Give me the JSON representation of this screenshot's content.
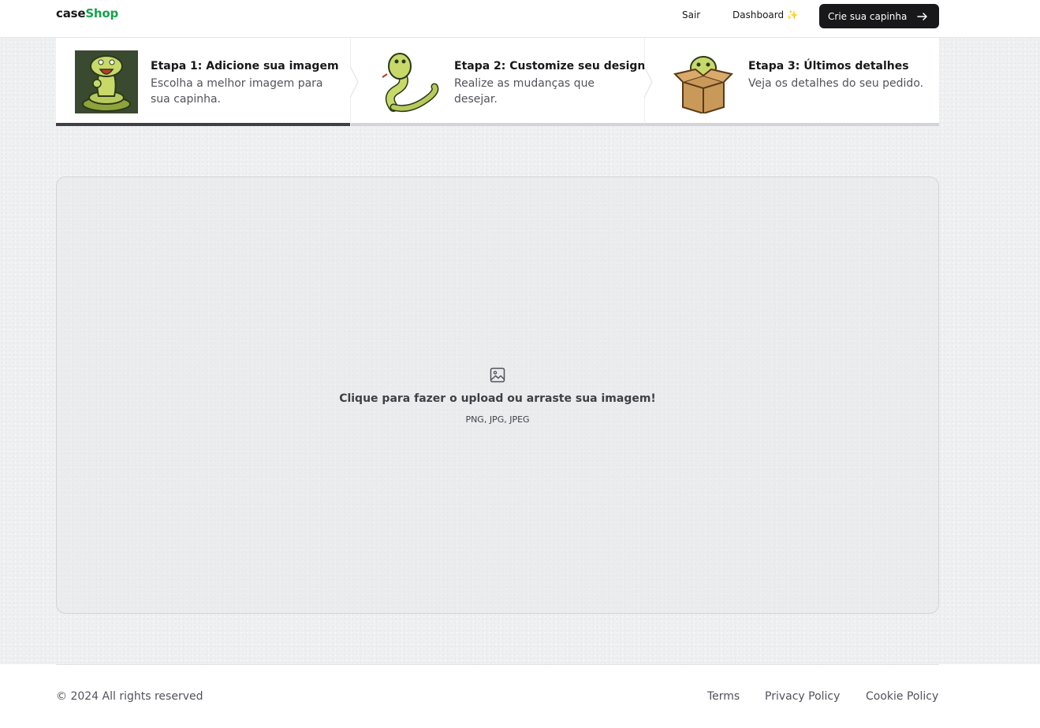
{
  "header": {
    "logo_part1": "case",
    "logo_part2": "Shop",
    "nav": {
      "logout": "Sair",
      "dashboard": "Dashboard ✨",
      "cta": "Crie sua capinha"
    }
  },
  "steps": [
    {
      "title": "Etapa 1: Adicione sua imagem",
      "description": "Escolha a melhor imagem para sua capinha.",
      "active": true
    },
    {
      "title": "Etapa 2: Customize seu design",
      "description": "Realize as mudanças que desejar.",
      "active": false
    },
    {
      "title": "Etapa 3: Últimos detalhes",
      "description": "Veja os detalhes do seu pedido.",
      "active": false
    }
  ],
  "upload": {
    "title": "Clique para fazer o upload ou arraste sua imagem!",
    "formats": "PNG, JPG, JPEG"
  },
  "footer": {
    "copyright": "© 2024 All rights reserved",
    "links": [
      "Terms",
      "Privacy Policy",
      "Cookie Policy"
    ]
  },
  "colors": {
    "brand_accent": "#16a34a",
    "primary_button": "#18181b",
    "snake_green": "#c8d96a"
  }
}
